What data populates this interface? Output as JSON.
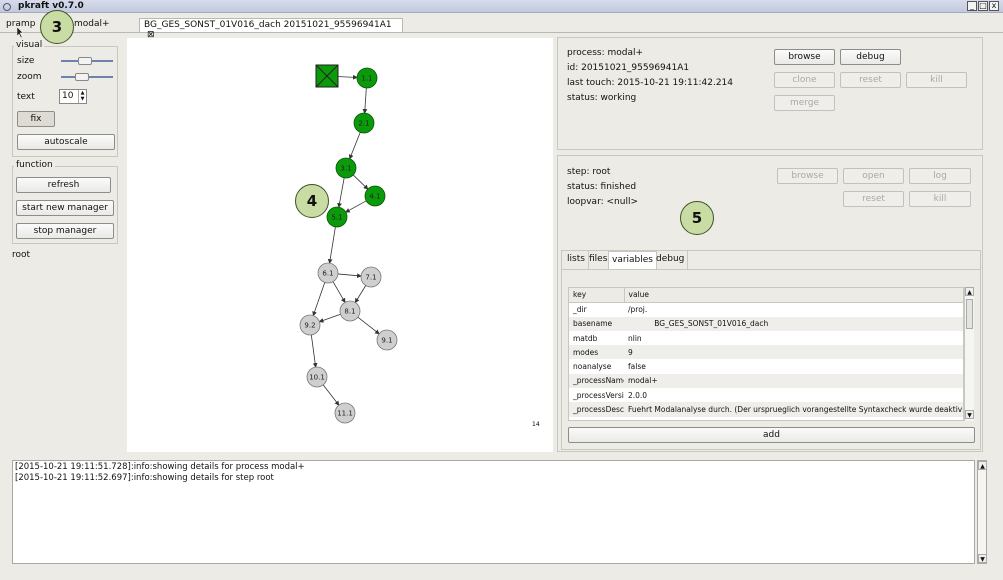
{
  "window": {
    "title": "pkraft v0.7.0",
    "min_label": "_",
    "max_label": "□",
    "close_label": "x"
  },
  "tabs": [
    {
      "label": "pramp"
    },
    {
      "label": "modal+"
    },
    {
      "label": "BG_GES_SONST_01V016_dach 20151021_95596941A1"
    }
  ],
  "tab_close_glyph": "⊠",
  "markers": {
    "m3": "3",
    "m4": "4",
    "m5": "5"
  },
  "left": {
    "visual_label": "visual",
    "size_label": "size",
    "zoom_label": "zoom",
    "text_label": "text",
    "text_value": "10",
    "size_level": 0.45,
    "zoom_level": 0.38,
    "fix_label": "fix",
    "autoscale_label": "autoscale",
    "function_label": "function",
    "refresh_label": "refresh",
    "start_label": "start new manager",
    "stop_label": "stop manager",
    "node_label": "root"
  },
  "graph": {
    "nodes": [
      {
        "label": "1.1",
        "status": "finished"
      },
      {
        "label": "2.1",
        "status": "finished"
      },
      {
        "label": "3.1",
        "status": "finished"
      },
      {
        "label": "4.1",
        "status": "finished"
      },
      {
        "label": "5.1",
        "status": "finished"
      },
      {
        "label": "6.1",
        "status": "waiting"
      },
      {
        "label": "7.1",
        "status": "waiting"
      },
      {
        "label": "8.1",
        "status": "waiting"
      },
      {
        "label": "9.2",
        "status": "waiting"
      },
      {
        "label": "9.1",
        "status": "waiting"
      },
      {
        "label": "10.1",
        "status": "waiting"
      },
      {
        "label": "11.1",
        "status": "waiting"
      }
    ],
    "corner_label": "14",
    "colors": {
      "finished": "#0a9a0a",
      "waiting": "#cfcfcf",
      "root": "#0a9a0a"
    }
  },
  "process": {
    "process_line": "process: modal+",
    "id_line": "id: 20151021_95596941A1",
    "touch_line": "last touch:  2015-10-21 19:11:42.214",
    "status_line": "status: working",
    "buttons": {
      "browse": "browse",
      "debug": "debug",
      "clone": "clone",
      "reset": "reset",
      "kill": "kill",
      "merge": "merge"
    }
  },
  "step": {
    "step_line": "step: root",
    "status_line": "status: finished",
    "loopvar_line": "loopvar: <null>",
    "buttons": {
      "browse": "browse",
      "open": "open",
      "log": "log",
      "reset": "reset",
      "kill": "kill"
    },
    "tabs": [
      "lists",
      "files",
      "variables",
      "debug"
    ],
    "table": {
      "headers": [
        "key",
        "value"
      ],
      "rows": [
        [
          "_dir",
          "/proj."
        ],
        [
          "basename",
          "           BG_GES_SONST_01V016_dach"
        ],
        [
          "matdb",
          "nlin"
        ],
        [
          "modes",
          "9"
        ],
        [
          "noanalyse",
          "false"
        ],
        [
          "_processName",
          "modal+"
        ],
        [
          "_processVersion",
          "2.0.0"
        ],
        [
          "_processDescription",
          "Fuehrt Modalanalyse durch. (Der ursprueglich vorangestellte Syntaxcheck wurde deaktiviert."
        ]
      ]
    },
    "add_label": "add"
  },
  "log": [
    "[2015-10-21 19:11:51.728]:info:showing details for process modal+",
    "[2015-10-21 19:11:52.697]:info:showing details for step root"
  ]
}
